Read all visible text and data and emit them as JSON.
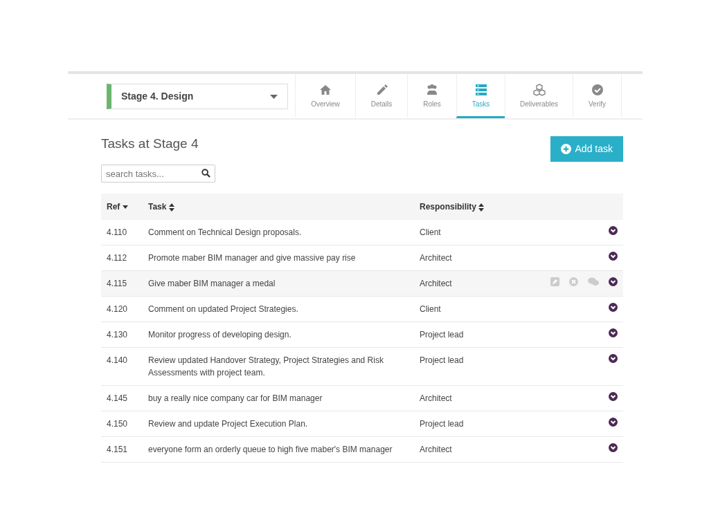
{
  "stage_select": {
    "value": "Stage 4. Design"
  },
  "tabs": [
    {
      "label": "Overview",
      "selected": false
    },
    {
      "label": "Details",
      "selected": false
    },
    {
      "label": "Roles",
      "selected": false
    },
    {
      "label": "Tasks",
      "selected": true
    },
    {
      "label": "Deliverables",
      "selected": false
    },
    {
      "label": "Verify",
      "selected": false
    }
  ],
  "heading": "Tasks at Stage 4",
  "add_button": "Add task",
  "search": {
    "placeholder": "search tasks..."
  },
  "table": {
    "columns": [
      {
        "label": "Ref",
        "kind": "sorted"
      },
      {
        "label": "Task",
        "kind": "sortable"
      },
      {
        "label": "Responsibility",
        "kind": "sortable"
      }
    ],
    "rows": [
      {
        "ref": "4.110",
        "task": "Comment on Technical Design proposals.",
        "responsibility": "Client",
        "highlighted": false
      },
      {
        "ref": "4.112",
        "task": "Promote maber BIM manager and give massive pay rise",
        "responsibility": "Architect",
        "highlighted": false
      },
      {
        "ref": "4.115",
        "task": "Give maber BIM manager a medal",
        "responsibility": "Architect",
        "highlighted": true
      },
      {
        "ref": "4.120",
        "task": "Comment on updated Project Strategies.",
        "responsibility": "Client",
        "highlighted": false
      },
      {
        "ref": "4.130",
        "task": "Monitor progress of developing design.",
        "responsibility": "Project lead",
        "highlighted": false
      },
      {
        "ref": "4.140",
        "task": "Review updated Handover Strategy, Project Strategies and Risk Assessments with project team.",
        "responsibility": "Project lead",
        "highlighted": false
      },
      {
        "ref": "4.145",
        "task": "buy a really nice company car for BIM manager",
        "responsibility": "Architect",
        "highlighted": false
      },
      {
        "ref": "4.150",
        "task": "Review and update Project Execution Plan.",
        "responsibility": "Project lead",
        "highlighted": false
      },
      {
        "ref": "4.151",
        "task": "everyone form an orderly queue to high five maber's BIM manager",
        "responsibility": "Architect",
        "highlighted": false
      }
    ]
  }
}
